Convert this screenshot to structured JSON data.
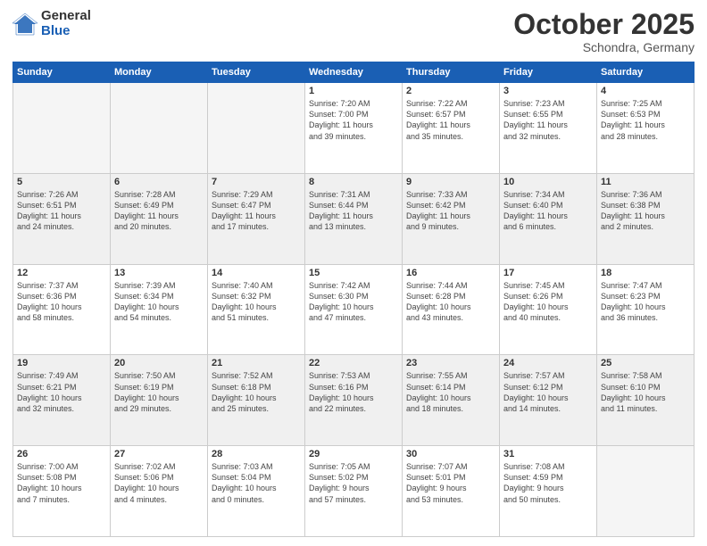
{
  "logo": {
    "general": "General",
    "blue": "Blue"
  },
  "header": {
    "month": "October 2025",
    "location": "Schondra, Germany"
  },
  "weekdays": [
    "Sunday",
    "Monday",
    "Tuesday",
    "Wednesday",
    "Thursday",
    "Friday",
    "Saturday"
  ],
  "weeks": [
    [
      {
        "num": "",
        "info": ""
      },
      {
        "num": "",
        "info": ""
      },
      {
        "num": "",
        "info": ""
      },
      {
        "num": "1",
        "info": "Sunrise: 7:20 AM\nSunset: 7:00 PM\nDaylight: 11 hours\nand 39 minutes."
      },
      {
        "num": "2",
        "info": "Sunrise: 7:22 AM\nSunset: 6:57 PM\nDaylight: 11 hours\nand 35 minutes."
      },
      {
        "num": "3",
        "info": "Sunrise: 7:23 AM\nSunset: 6:55 PM\nDaylight: 11 hours\nand 32 minutes."
      },
      {
        "num": "4",
        "info": "Sunrise: 7:25 AM\nSunset: 6:53 PM\nDaylight: 11 hours\nand 28 minutes."
      }
    ],
    [
      {
        "num": "5",
        "info": "Sunrise: 7:26 AM\nSunset: 6:51 PM\nDaylight: 11 hours\nand 24 minutes."
      },
      {
        "num": "6",
        "info": "Sunrise: 7:28 AM\nSunset: 6:49 PM\nDaylight: 11 hours\nand 20 minutes."
      },
      {
        "num": "7",
        "info": "Sunrise: 7:29 AM\nSunset: 6:47 PM\nDaylight: 11 hours\nand 17 minutes."
      },
      {
        "num": "8",
        "info": "Sunrise: 7:31 AM\nSunset: 6:44 PM\nDaylight: 11 hours\nand 13 minutes."
      },
      {
        "num": "9",
        "info": "Sunrise: 7:33 AM\nSunset: 6:42 PM\nDaylight: 11 hours\nand 9 minutes."
      },
      {
        "num": "10",
        "info": "Sunrise: 7:34 AM\nSunset: 6:40 PM\nDaylight: 11 hours\nand 6 minutes."
      },
      {
        "num": "11",
        "info": "Sunrise: 7:36 AM\nSunset: 6:38 PM\nDaylight: 11 hours\nand 2 minutes."
      }
    ],
    [
      {
        "num": "12",
        "info": "Sunrise: 7:37 AM\nSunset: 6:36 PM\nDaylight: 10 hours\nand 58 minutes."
      },
      {
        "num": "13",
        "info": "Sunrise: 7:39 AM\nSunset: 6:34 PM\nDaylight: 10 hours\nand 54 minutes."
      },
      {
        "num": "14",
        "info": "Sunrise: 7:40 AM\nSunset: 6:32 PM\nDaylight: 10 hours\nand 51 minutes."
      },
      {
        "num": "15",
        "info": "Sunrise: 7:42 AM\nSunset: 6:30 PM\nDaylight: 10 hours\nand 47 minutes."
      },
      {
        "num": "16",
        "info": "Sunrise: 7:44 AM\nSunset: 6:28 PM\nDaylight: 10 hours\nand 43 minutes."
      },
      {
        "num": "17",
        "info": "Sunrise: 7:45 AM\nSunset: 6:26 PM\nDaylight: 10 hours\nand 40 minutes."
      },
      {
        "num": "18",
        "info": "Sunrise: 7:47 AM\nSunset: 6:23 PM\nDaylight: 10 hours\nand 36 minutes."
      }
    ],
    [
      {
        "num": "19",
        "info": "Sunrise: 7:49 AM\nSunset: 6:21 PM\nDaylight: 10 hours\nand 32 minutes."
      },
      {
        "num": "20",
        "info": "Sunrise: 7:50 AM\nSunset: 6:19 PM\nDaylight: 10 hours\nand 29 minutes."
      },
      {
        "num": "21",
        "info": "Sunrise: 7:52 AM\nSunset: 6:18 PM\nDaylight: 10 hours\nand 25 minutes."
      },
      {
        "num": "22",
        "info": "Sunrise: 7:53 AM\nSunset: 6:16 PM\nDaylight: 10 hours\nand 22 minutes."
      },
      {
        "num": "23",
        "info": "Sunrise: 7:55 AM\nSunset: 6:14 PM\nDaylight: 10 hours\nand 18 minutes."
      },
      {
        "num": "24",
        "info": "Sunrise: 7:57 AM\nSunset: 6:12 PM\nDaylight: 10 hours\nand 14 minutes."
      },
      {
        "num": "25",
        "info": "Sunrise: 7:58 AM\nSunset: 6:10 PM\nDaylight: 10 hours\nand 11 minutes."
      }
    ],
    [
      {
        "num": "26",
        "info": "Sunrise: 7:00 AM\nSunset: 5:08 PM\nDaylight: 10 hours\nand 7 minutes."
      },
      {
        "num": "27",
        "info": "Sunrise: 7:02 AM\nSunset: 5:06 PM\nDaylight: 10 hours\nand 4 minutes."
      },
      {
        "num": "28",
        "info": "Sunrise: 7:03 AM\nSunset: 5:04 PM\nDaylight: 10 hours\nand 0 minutes."
      },
      {
        "num": "29",
        "info": "Sunrise: 7:05 AM\nSunset: 5:02 PM\nDaylight: 9 hours\nand 57 minutes."
      },
      {
        "num": "30",
        "info": "Sunrise: 7:07 AM\nSunset: 5:01 PM\nDaylight: 9 hours\nand 53 minutes."
      },
      {
        "num": "31",
        "info": "Sunrise: 7:08 AM\nSunset: 4:59 PM\nDaylight: 9 hours\nand 50 minutes."
      },
      {
        "num": "",
        "info": ""
      }
    ]
  ]
}
